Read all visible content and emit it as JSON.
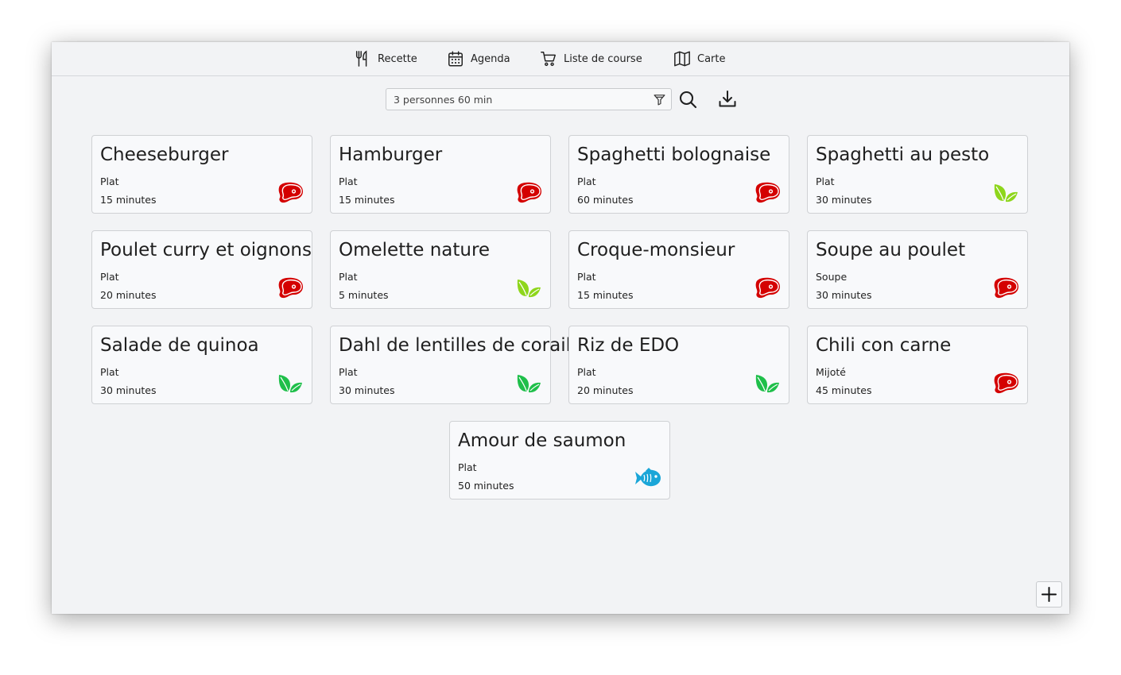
{
  "nav": {
    "items": [
      {
        "label": "Recette",
        "icon": "fork-knife-icon"
      },
      {
        "label": "Agenda",
        "icon": "calendar-icon"
      },
      {
        "label": "Liste de course",
        "icon": "cart-icon"
      },
      {
        "label": "Carte",
        "icon": "map-icon"
      }
    ]
  },
  "search": {
    "value": "3 personnes 60 min",
    "filter_icon": "filter-icon",
    "search_icon": "search-icon",
    "download_icon": "download-icon"
  },
  "colors": {
    "meat": "#d40000",
    "veggie": "#1fbf4a",
    "veggie_light": "#8ed61c",
    "fish": "#1aa6d8"
  },
  "recipes": [
    {
      "title": "Cheeseburger",
      "category": "Plat",
      "time": "15 minutes",
      "type": "meat-icon"
    },
    {
      "title": "Hamburger",
      "category": "Plat",
      "time": "15 minutes",
      "type": "meat-icon"
    },
    {
      "title": "Spaghetti bolognaise",
      "category": "Plat",
      "time": "60 minutes",
      "type": "meat-icon"
    },
    {
      "title": "Spaghetti au pesto",
      "category": "Plat",
      "time": "30 minutes",
      "type": "leaf-light-icon"
    },
    {
      "title": "Poulet curry et oignons",
      "category": "Plat",
      "time": "20 minutes",
      "type": "meat-icon"
    },
    {
      "title": "Omelette nature",
      "category": "Plat",
      "time": "5 minutes",
      "type": "leaf-light-icon"
    },
    {
      "title": "Croque-monsieur",
      "category": "Plat",
      "time": "15 minutes",
      "type": "meat-icon"
    },
    {
      "title": "Soupe au poulet",
      "category": "Soupe",
      "time": "30 minutes",
      "type": "meat-icon"
    },
    {
      "title": "Salade de quinoa",
      "category": "Plat",
      "time": "30 minutes",
      "type": "leaf-icon"
    },
    {
      "title": "Dahl de lentilles de corail",
      "category": "Plat",
      "time": "30 minutes",
      "type": "leaf-icon"
    },
    {
      "title": "Riz de EDO",
      "category": "Plat",
      "time": "20 minutes",
      "type": "leaf-icon"
    },
    {
      "title": "Chili con carne",
      "category": "Mijoté",
      "time": "45 minutes",
      "type": "meat-icon"
    },
    {
      "title": "Amour de saumon",
      "category": "Plat",
      "time": "50 minutes",
      "type": "fish-icon"
    }
  ],
  "add_icon": "plus-icon"
}
